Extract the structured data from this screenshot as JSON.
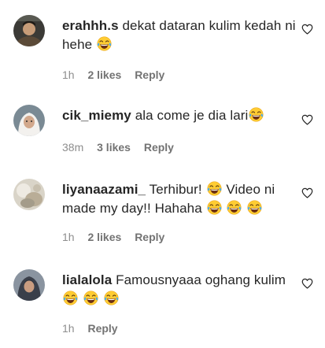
{
  "comments": [
    {
      "username": "erahhh.s",
      "text_parts": [
        "dekat dataran kulim kedah ni hehe"
      ],
      "emoji_count": 1,
      "time": "1h",
      "likes": "2 likes",
      "reply": "Reply",
      "avatar_icon": "profile-photo-dark-portrait"
    },
    {
      "username": "cik_miemy",
      "text_parts": [
        "ala come je dia lari"
      ],
      "emoji_count": 1,
      "time": "38m",
      "likes": "3 likes",
      "reply": "Reply",
      "avatar_icon": "profile-photo-white-hijab"
    },
    {
      "username": "liyanaazami_",
      "text_parts": [
        "Terhibur!",
        "Video ni made my day!! Hahaha"
      ],
      "emoji_count": 4,
      "time": "1h",
      "likes": "2 likes",
      "reply": "Reply",
      "avatar_icon": "profile-photo-light-blur"
    },
    {
      "username": "lialalola",
      "text_parts": [
        "Famousnyaaa oghang kulim"
      ],
      "emoji_count": 3,
      "time": "1h",
      "likes": "",
      "reply": "Reply",
      "avatar_icon": "profile-photo-dark-hijab"
    }
  ],
  "icons": {
    "emoji": "face-with-tears-of-joy-emoji",
    "like": "heart-outline-icon"
  },
  "colors": {
    "text": "#262626",
    "meta": "#8e8e8e",
    "emoji_face": "#ffcc33"
  }
}
